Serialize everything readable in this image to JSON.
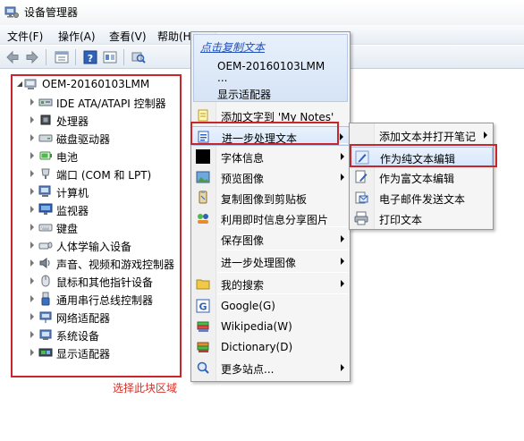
{
  "window": {
    "title": "设备管理器",
    "menus": [
      "文件(F)",
      "操作(A)",
      "查看(V)",
      "帮助(H)"
    ]
  },
  "tree": {
    "root": "OEM-20160103LMM",
    "children": [
      {
        "label": "IDE ATA/ATAPI 控制器",
        "icon": "ide-controller-icon"
      },
      {
        "label": "处理器",
        "icon": "processor-icon"
      },
      {
        "label": "磁盘驱动器",
        "icon": "disk-drive-icon"
      },
      {
        "label": "电池",
        "icon": "battery-icon"
      },
      {
        "label": "端口 (COM 和 LPT)",
        "icon": "port-icon"
      },
      {
        "label": "计算机",
        "icon": "computer-icon"
      },
      {
        "label": "监视器",
        "icon": "monitor-icon"
      },
      {
        "label": "键盘",
        "icon": "keyboard-icon"
      },
      {
        "label": "人体学输入设备",
        "icon": "hid-icon"
      },
      {
        "label": "声音、视频和游戏控制器",
        "icon": "sound-icon"
      },
      {
        "label": "鼠标和其他指针设备",
        "icon": "mouse-icon"
      },
      {
        "label": "通用串行总线控制器",
        "icon": "usb-icon"
      },
      {
        "label": "网络适配器",
        "icon": "network-adapter-icon"
      },
      {
        "label": "系统设备",
        "icon": "system-device-icon"
      },
      {
        "label": "显示适配器",
        "icon": "display-adapter-icon"
      }
    ],
    "caption": "选择此块区域"
  },
  "context_menu": {
    "header": {
      "link": "点击复制文本",
      "lines": [
        "OEM-20160103LMM",
        "...",
        "显示适配器"
      ]
    },
    "items": [
      {
        "label": "添加文字到 'My Notes'",
        "icon": "note-icon",
        "submenu": false
      },
      {
        "label": "进一步处理文本",
        "icon": "text-process-icon",
        "submenu": true,
        "highlighted": true
      },
      {
        "label": "字体信息",
        "icon": "font-info-icon",
        "submenu": true
      },
      {
        "label": "预览图像",
        "icon": "image-preview-icon",
        "submenu": true
      },
      {
        "label": "复制图像到剪贴板",
        "icon": "copy-image-icon",
        "submenu": false
      },
      {
        "label": "利用即时信息分享图片",
        "icon": "share-image-icon",
        "submenu": false
      },
      {
        "label": "保存图像",
        "icon": "save-image-icon",
        "submenu": true
      },
      {
        "label": "进一步处理图像",
        "icon": "image-process-icon",
        "submenu": true
      },
      {
        "label": "我的搜索",
        "icon": "folder-search-icon",
        "submenu": true
      },
      {
        "label": "Google(G)",
        "icon": "google-icon",
        "submenu": false
      },
      {
        "label": "Wikipedia(W)",
        "icon": "wikipedia-icon",
        "submenu": false
      },
      {
        "label": "Dictionary(D)",
        "icon": "dictionary-icon",
        "submenu": false
      },
      {
        "label": "更多站点...",
        "icon": "more-sites-icon",
        "submenu": true
      }
    ]
  },
  "submenu": {
    "items": [
      {
        "label": "添加文本并打开笔记",
        "icon": "add-note-icon",
        "submenu": true
      },
      {
        "label": "作为纯文本编辑",
        "icon": "edit-plain-icon",
        "submenu": false,
        "highlighted": true
      },
      {
        "label": "作为富文本编辑",
        "icon": "edit-rich-icon",
        "submenu": false
      },
      {
        "label": "电子邮件发送文本",
        "icon": "email-icon",
        "submenu": false
      },
      {
        "label": "打印文本",
        "icon": "print-icon",
        "submenu": false
      }
    ]
  },
  "colors": {
    "annotation_red": "#c8262b",
    "link_blue": "#1f4fb8"
  }
}
